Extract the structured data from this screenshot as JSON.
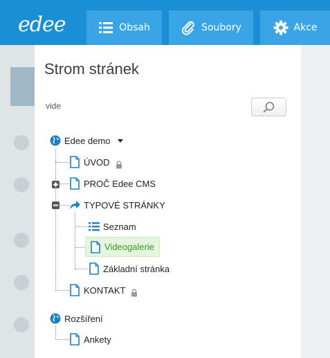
{
  "header": {
    "logo": "edee",
    "nav": [
      {
        "label": "Obsah",
        "icon": "list-icon"
      },
      {
        "label": "Soubory",
        "icon": "paperclip-icon"
      },
      {
        "label": "Akce",
        "icon": "gear-icon"
      }
    ]
  },
  "panel": {
    "title": "Strom stránek",
    "search": {
      "value": "vide",
      "button_icon": "search-icon"
    }
  },
  "tree": [
    {
      "label": "Edee demo",
      "icon": "globe-icon",
      "level": 0,
      "dropdown": true
    },
    {
      "label": "ÚVOD",
      "icon": "page-icon",
      "level": 1,
      "locked": true
    },
    {
      "label": "PROČ Edee CMS",
      "icon": "page-icon",
      "level": 1,
      "toggle": "expand"
    },
    {
      "label": "TYPOVÉ STRÁNKY",
      "icon": "redirect-arrow-icon",
      "level": 1,
      "toggle": "collapse"
    },
    {
      "label": "Seznam",
      "icon": "list-icon",
      "level": 2
    },
    {
      "label": "Videogalerie",
      "icon": "page-icon",
      "level": 2,
      "selected": true
    },
    {
      "label": "Základní stránka",
      "icon": "page-icon",
      "level": 2
    },
    {
      "label": "KONTAKT",
      "icon": "page-icon",
      "level": 1,
      "locked": true
    },
    {
      "label": "Rozšíření",
      "icon": "globe-icon",
      "level": 0
    },
    {
      "label": "Ankety",
      "icon": "page-icon",
      "level": 1
    }
  ],
  "colors": {
    "header": "#1a8fd6",
    "nav_button": "#3aa5e6",
    "selected_bg": "#e6f5dd",
    "selected_text": "#3b9a2a",
    "icon_blue": "#1a7fc4"
  }
}
